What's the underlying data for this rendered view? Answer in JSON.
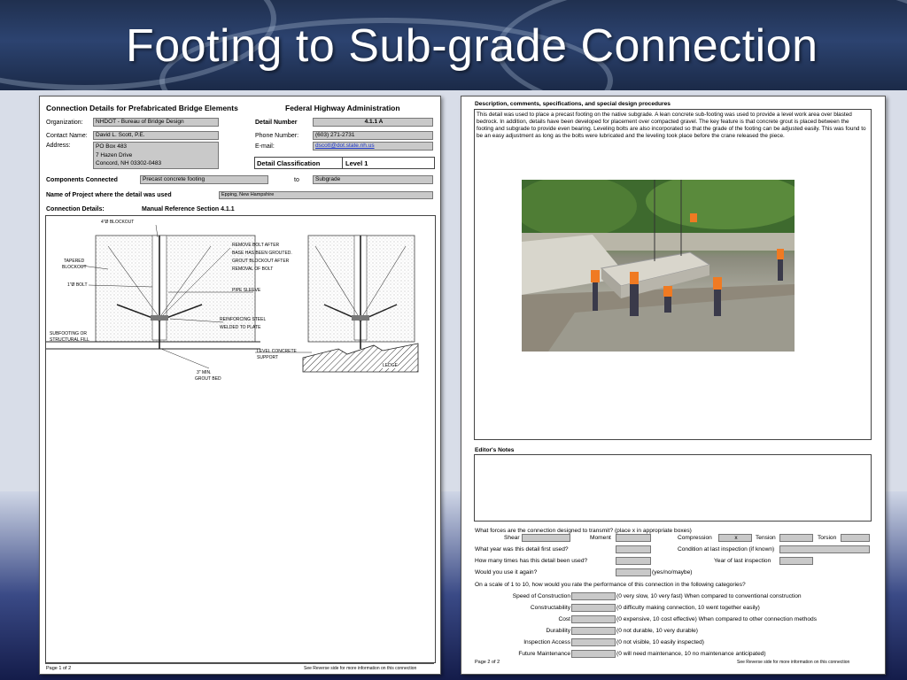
{
  "slide": {
    "title": "Footing to Sub-grade Connection"
  },
  "page1": {
    "header_left": "Connection Details for Prefabricated Bridge Elements",
    "header_right": "Federal Highway Administration",
    "organization_label": "Organization:",
    "organization": "NHDOT - Bureau of Bridge Design",
    "contact_label": "Contact Name:",
    "contact": "David L. Scott, P.E.",
    "address_label": "Address:",
    "address_line1": "PO Box 483",
    "address_line2": "7 Hazen Drive",
    "address_line3": "Concord, NH 03302-0483",
    "detail_number_label": "Detail Number",
    "detail_number": "4.1.1 A",
    "phone_label": "Phone Number:",
    "phone": "(603) 271-2731",
    "email_label": "E-mail:",
    "email": "dscott@dot.state.nh.us",
    "detail_class_label": "Detail Classification",
    "detail_class": "Level 1",
    "components_label": "Components Connected",
    "component_a": "Precast concrete footing",
    "to_label": "to",
    "component_b": "Subgrade",
    "project_label": "Name of Project where the detail was used",
    "project": "Epping, New Hampshire",
    "connection_label": "Connection Details:",
    "manual_ref": "Manual Reference Section 4.1.1",
    "drawing_labels": {
      "blockout": "4\"Ø BLOCKOUT",
      "tapered": "TAPERED",
      "tapered2": "BLOCKOUT",
      "bolt": "1\"Ø BOLT",
      "subfooting": "SUBFOOTING OR",
      "subfooting2": "STRUCTURAL FILL",
      "remove1": "REMOVE BOLT AFTER",
      "remove2": "BASE HAS BEEN GROUTED.",
      "remove3": "GROUT BLOCKOUT AFTER",
      "remove4": "REMOVAL OF BOLT",
      "pipe": "PIPE SLEEVE",
      "reinf1": "REINFORCING STEEL",
      "reinf2": "WELDED TO PLATE",
      "level1": "LEVEL CONCRETE",
      "level2": "SUPPORT",
      "ledge": "LEDGE",
      "grout1": "3\" MIN.",
      "grout2": "GROUT BED"
    },
    "footer_left": "Page 1 of 2",
    "footer_right": "See Reverse side for more information on this connection"
  },
  "page2": {
    "desc_header": "Description, comments, specifications, and special design procedures",
    "desc_text": "This detail was used to place a precast footing on the native subgrade.  A lean concrete sub-footing was used to provide a level work area over blasted bedrock.  In addition, details have been developed for placement over compacted gravel.  The key feature is that concrete grout is placed between the footing and subgrade to provide even bearing.  Leveling bolts are also incorporated so that the grade of the footing can be adjusted easily.  This was found to be an easy adjustment as long as the bolts were lubricated and the leveling took place before the crane released the piece.",
    "editors_notes": "Editor's Notes",
    "forces_q": "What forces are the connection designed to transmit?  (place x in appropriate boxes)",
    "shear": "Shear",
    "moment": "Moment",
    "compression": "Compression",
    "compression_val": "x",
    "tension": "Tension",
    "torsion": "Torsion",
    "year_q": "What year was this detail first used?",
    "condition_q": "Condition at last inspection (if known)",
    "times_q": "How many times has this detail been used?",
    "year_insp": "Year of last inspection",
    "use_again_q": "Would you use it again?",
    "use_again_hint": "(yes/no/maybe)",
    "scale_q": "On a scale of 1 to 10, how would you rate the performance of this connection in the following categories?",
    "ratings": [
      {
        "label": "Speed of Construction",
        "hint": "(0 very slow, 10 very fast)  When compared to conventional construction"
      },
      {
        "label": "Constructability",
        "hint": "(0 difficulty making connection, 10 went together easily)"
      },
      {
        "label": "Cost",
        "hint": "(0 expensive, 10 cost effective)  When compared to other connection methods"
      },
      {
        "label": "Durability",
        "hint": "(0 not durable, 10 very durable)"
      },
      {
        "label": "Inspection Access",
        "hint": "(0 not visible, 10 easily inspected)"
      },
      {
        "label": "Future Maintenance",
        "hint": "(0 will need maintenance, 10 no maintenance anticipated)"
      }
    ],
    "footer_left": "Page 2 of 2",
    "footer_right": "See Reverse side for more information on this connection"
  },
  "colors": {
    "banner": "#2c4370",
    "field": "#c9c9c9",
    "link": "#1a34c8"
  }
}
